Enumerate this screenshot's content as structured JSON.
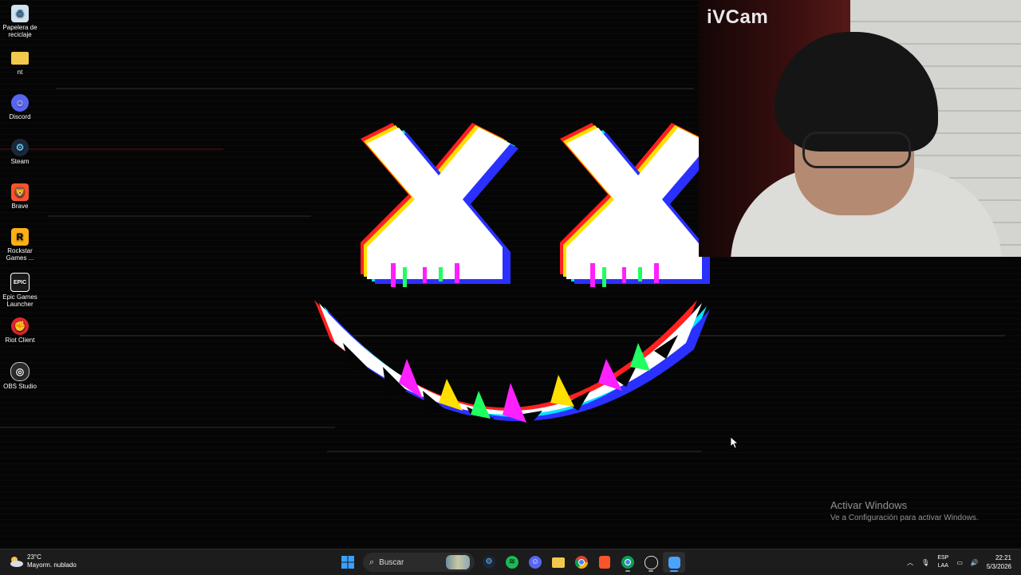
{
  "desktop": {
    "icons": [
      {
        "label": "Papelera de reciclaje",
        "icon": "recycle-bin-icon"
      },
      {
        "label": "nt",
        "icon": "folder-icon"
      },
      {
        "label": "Discord",
        "icon": "discord-icon"
      },
      {
        "label": "Steam",
        "icon": "steam-icon"
      },
      {
        "label": "Brave",
        "icon": "brave-icon"
      },
      {
        "label": "Rockstar Games ...",
        "icon": "rockstar-icon"
      },
      {
        "label": "Epic Games Launcher",
        "icon": "epic-games-icon"
      },
      {
        "label": "Riot Client",
        "icon": "riot-icon"
      },
      {
        "label": "OBS Studio",
        "icon": "obs-icon"
      }
    ]
  },
  "webcam": {
    "label": "iVCam"
  },
  "watermark": {
    "title": "Activar Windows",
    "subtitle": "Ve a Configuración para activar Windows."
  },
  "taskbar": {
    "weather": {
      "temp": "23°C",
      "condition": "Mayorm. nublado"
    },
    "search_placeholder": "Buscar",
    "apps": [
      "start-icon",
      "search-icon",
      "steam-icon",
      "spotify-icon",
      "discord-icon",
      "file-explorer-icon",
      "chrome-icon",
      "brave-icon",
      "chrome-profile-icon",
      "obs-icon",
      "ivcam-icon"
    ],
    "tray": {
      "lang_line1": "ESP",
      "lang_line2": "LAA",
      "time": "22:21",
      "date": "5/3/2026"
    }
  },
  "colors": {
    "taskbar_bg": "#1c1c1c",
    "desktop_bg": "#050505",
    "windows_accent": "#1e90ff"
  }
}
